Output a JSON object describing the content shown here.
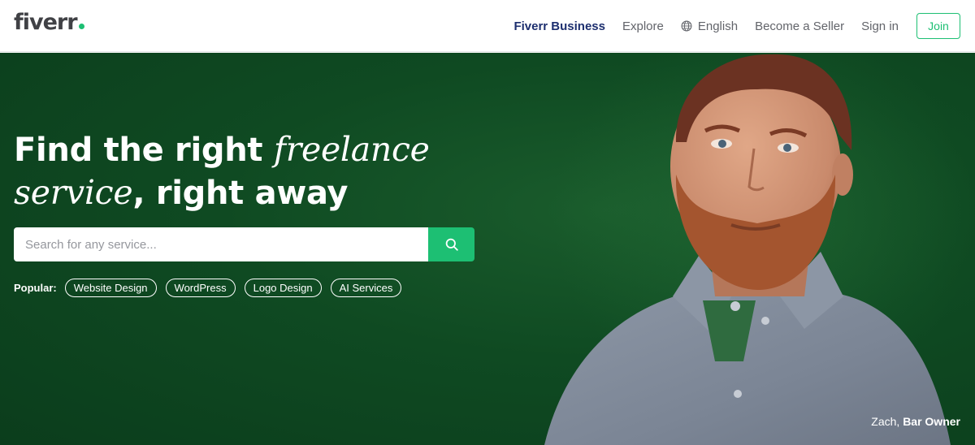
{
  "brand": {
    "logo_text": "fiverr",
    "dot_color": "#1dbf73",
    "accent": "#1dbf73"
  },
  "nav": {
    "business": "Fiverr Business",
    "explore": "Explore",
    "language": "English",
    "become_seller": "Become a Seller",
    "sign_in": "Sign in",
    "join": "Join"
  },
  "hero": {
    "headline": {
      "part1": "Find the right ",
      "italic1": "freelance",
      "italic2": "service",
      "part2": ", right away"
    },
    "search": {
      "placeholder": "Search for any service..."
    },
    "popular_label": "Popular:",
    "popular_tags": [
      "Website Design",
      "WordPress",
      "Logo Design",
      "AI Services"
    ],
    "caption": {
      "name": "Zach,",
      "role": "Bar Owner"
    },
    "bg_color": "#0f4a22"
  },
  "icons": {
    "search": "search-icon",
    "globe": "globe-icon"
  }
}
